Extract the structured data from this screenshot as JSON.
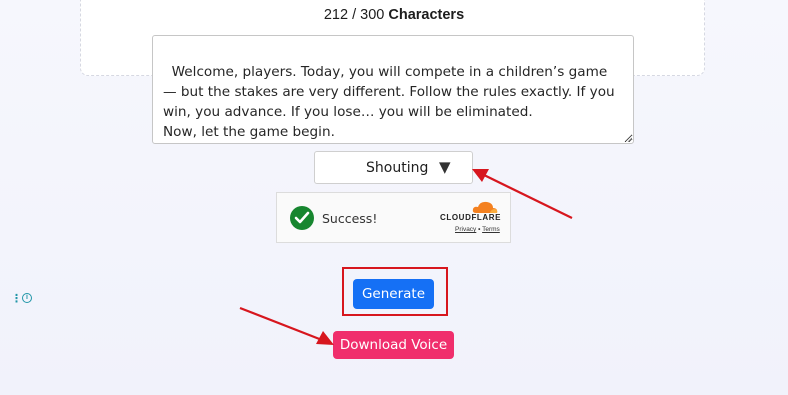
{
  "counter": {
    "current": "212 / 300",
    "label": "Characters"
  },
  "script_text": "Welcome, players. Today, you will compete in a children’s game — but the stakes are very different. Follow the rules exactly. If you win, you advance. If you lose… you will be eliminated.\nNow, let the game begin.",
  "voice_style": {
    "selected": "Shouting",
    "caret": "▼"
  },
  "captcha": {
    "status": "Success!",
    "brand": "CLOUDFLARE",
    "privacy": "Privacy",
    "separator": "•",
    "terms": "Terms"
  },
  "side": {
    "dots": "⋮",
    "info": "i"
  },
  "buttons": {
    "generate": "Generate",
    "download": "Download Voice"
  },
  "colors": {
    "generate": "#1570f5",
    "download": "#f02e6c",
    "annotation": "#d7161e",
    "success": "#17862f"
  },
  "icons": [
    "checkmark-icon",
    "cloudflare-icon",
    "dropdown-caret-icon",
    "more-icon",
    "info-icon",
    "resize-grip-icon"
  ]
}
